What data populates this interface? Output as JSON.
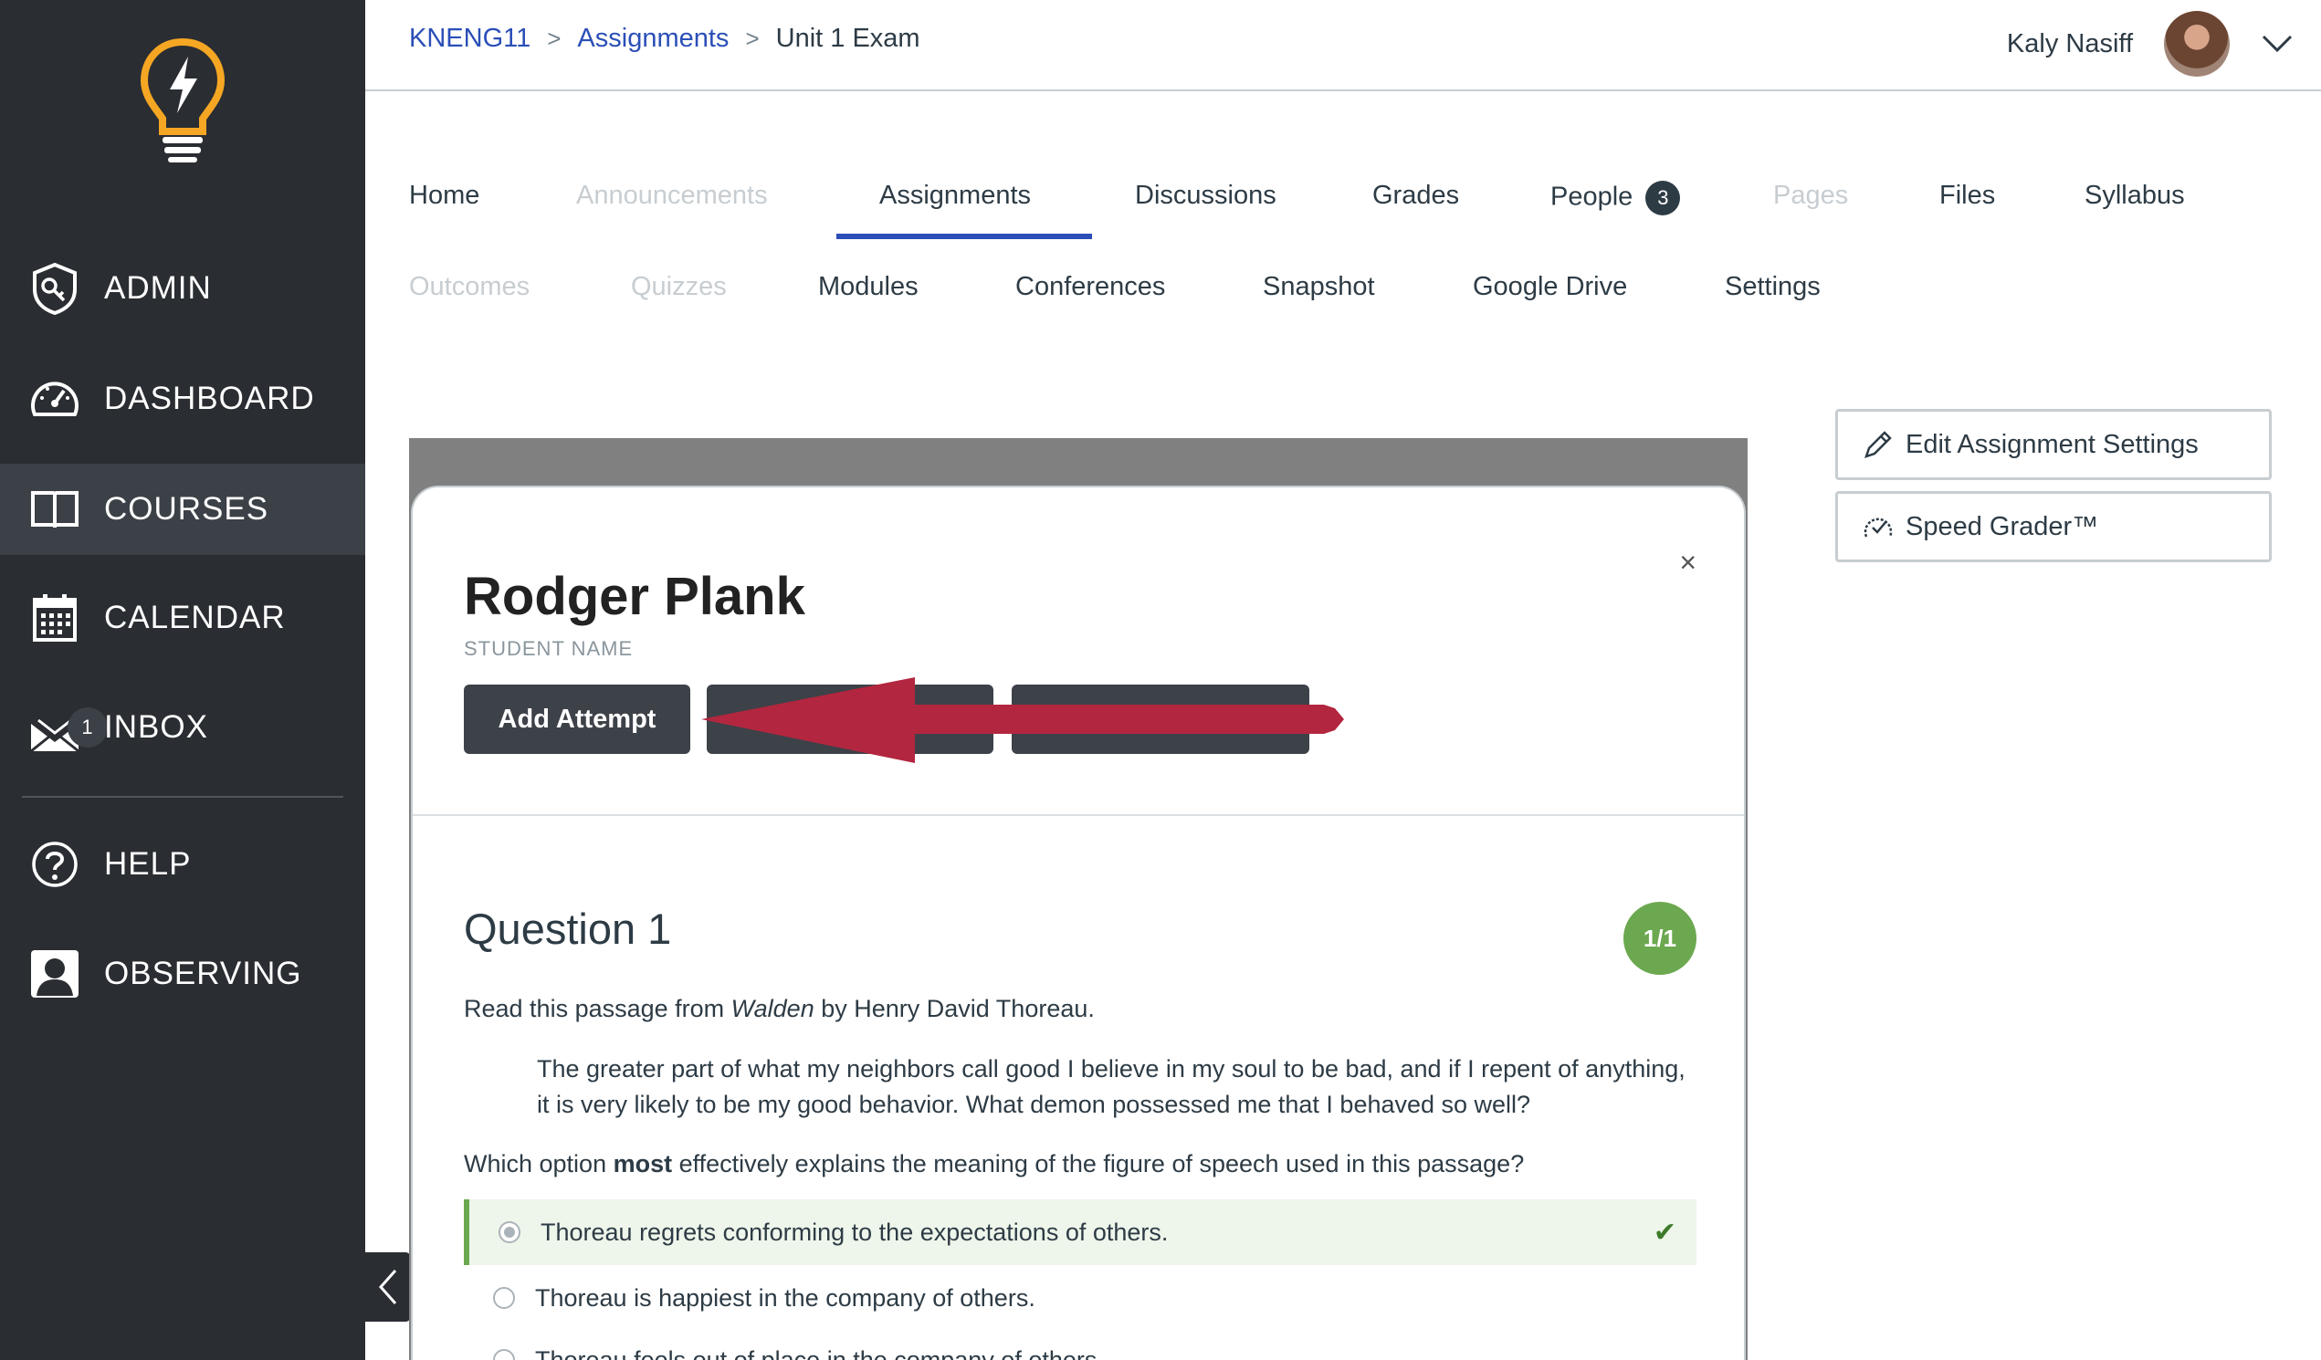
{
  "sidebar": {
    "items": [
      {
        "label": "ADMIN",
        "icon": "shield-key-icon"
      },
      {
        "label": "DASHBOARD",
        "icon": "speedometer-icon"
      },
      {
        "label": "COURSES",
        "icon": "book-icon"
      },
      {
        "label": "CALENDAR",
        "icon": "calendar-icon"
      },
      {
        "label": "INBOX",
        "icon": "inbox-icon",
        "badge": "1"
      },
      {
        "label": "HELP",
        "icon": "help-icon"
      },
      {
        "label": "OBSERVING",
        "icon": "observer-icon"
      }
    ],
    "active": "COURSES",
    "accent": "#f5a623"
  },
  "breadcrumb": {
    "course": "KNENG11",
    "section": "Assignments",
    "current": "Unit 1 Exam"
  },
  "user": {
    "name": "Kaly Nasiff"
  },
  "course_nav": {
    "row1": [
      "Home",
      "Announcements",
      "Assignments",
      "Discussions",
      "Grades",
      "People",
      "Pages",
      "Files",
      "Syllabus"
    ],
    "row2": [
      "Outcomes",
      "Quizzes",
      "Modules",
      "Conferences",
      "Snapshot",
      "Google Drive",
      "Settings"
    ],
    "people_badge": "3",
    "active": "Assignments",
    "accent": "#2b4fb7"
  },
  "side_buttons": {
    "edit": "Edit Assignment Settings",
    "speedgrader": "Speed Grader™"
  },
  "modal": {
    "student_name": "Rodger Plank",
    "student_label": "STUDENT NAME",
    "add_attempt": "Add Attempt",
    "close": "×"
  },
  "question": {
    "title": "Question 1",
    "score": "1/1",
    "intro_before": "Read this passage from ",
    "intro_italic": "Walden",
    "intro_after": " by Henry David Thoreau.",
    "passage": "The greater part of what my neighbors call good I believe in my soul to be bad, and if I repent of anything, it is very likely to be my good behavior. What demon possessed me that I behaved so well?",
    "prompt_before": "Which option ",
    "prompt_bold": "most",
    "prompt_after": " effectively explains the meaning of the figure of speech used in this passage?",
    "answers": [
      "Thoreau regrets conforming to the expectations of others.",
      "Thoreau is happiest in the company of others.",
      "Thoreau feels out of place in the company of others."
    ],
    "correct_color": "#6ba84f"
  },
  "annotation": {
    "arrow_color": "#b3263f"
  }
}
